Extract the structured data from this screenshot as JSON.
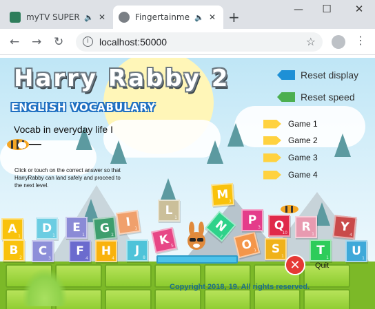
{
  "browser": {
    "tabs": [
      {
        "title": "myTV SUPER",
        "audio_icon": "speaker-icon",
        "favicon_color": "#2e7d5b"
      },
      {
        "title": "Fingertainme",
        "audio_icon": "speaker-icon",
        "favicon_color": "#7a7f85"
      }
    ],
    "new_tab_symbol": "+",
    "window_controls": {
      "minimize": "—",
      "maximize": "☐",
      "close": "✕"
    },
    "nav": {
      "back": "←",
      "forward": "→",
      "reload": "↻"
    },
    "url": "localhost:50000",
    "info_symbol": "i",
    "star_symbol": "☆",
    "menu_symbol": "⋮"
  },
  "game": {
    "logo": "Harry Rabby 2",
    "subtitle": "ENGLISH VOCABULARY",
    "section": "Vocab in everyday life I",
    "instructions": "Click or touch on the correct answer so that HarryRabby can land safely and proceed to the next level.",
    "controls": {
      "reset_display": "Reset display",
      "reset_speed": "Reset speed",
      "reset_display_color": "#1e90d6",
      "reset_speed_color": "#4caf50"
    },
    "game_levels": [
      "Game 1",
      "Game 2",
      "Game 3",
      "Game 4"
    ],
    "tiles": [
      {
        "letter": "A",
        "color": "#f9c20c",
        "num": "1"
      },
      {
        "letter": "B",
        "color": "#f9c20c",
        "num": "2"
      },
      {
        "letter": "D",
        "color": "#6ccde2",
        "num": "1"
      },
      {
        "letter": "C",
        "color": "#8d8fd9",
        "num": "3"
      },
      {
        "letter": "E",
        "color": "#8b8bd6",
        "num": "1"
      },
      {
        "letter": "F",
        "color": "#6b6bce",
        "num": "4"
      },
      {
        "letter": "G",
        "color": "#3e9e6e",
        "num": "2"
      },
      {
        "letter": "H",
        "color": "#f9b20c",
        "num": "4"
      },
      {
        "letter": "I",
        "color": "#f0a06c",
        "num": "1"
      },
      {
        "letter": "J",
        "color": "#4ec3d9",
        "num": "8"
      },
      {
        "letter": "L",
        "color": "#cbbf9a",
        "num": "1"
      },
      {
        "letter": "K",
        "color": "#e74786",
        "num": "5"
      },
      {
        "letter": "M",
        "color": "#f9c20c",
        "num": "3"
      },
      {
        "letter": "N",
        "color": "#2fd28a",
        "num": "1"
      },
      {
        "letter": "O",
        "color": "#f4964a",
        "num": "1"
      },
      {
        "letter": "P",
        "color": "#e43c8a",
        "num": "3"
      },
      {
        "letter": "S",
        "color": "#f0b21a",
        "num": "1"
      },
      {
        "letter": "Q",
        "color": "#e0294a",
        "num": "10"
      },
      {
        "letter": "R",
        "color": "#e89ab0",
        "num": "1"
      },
      {
        "letter": "T",
        "color": "#2ecc5a",
        "num": "1"
      },
      {
        "letter": "Y",
        "color": "#c94a4a",
        "num": "4"
      },
      {
        "letter": "U",
        "color": "#3fa9d9",
        "num": "1"
      }
    ],
    "copyright": "Copyright 2018, 19. All rights reserved.",
    "quit_label": "Quit",
    "quit_symbol": "✕"
  }
}
